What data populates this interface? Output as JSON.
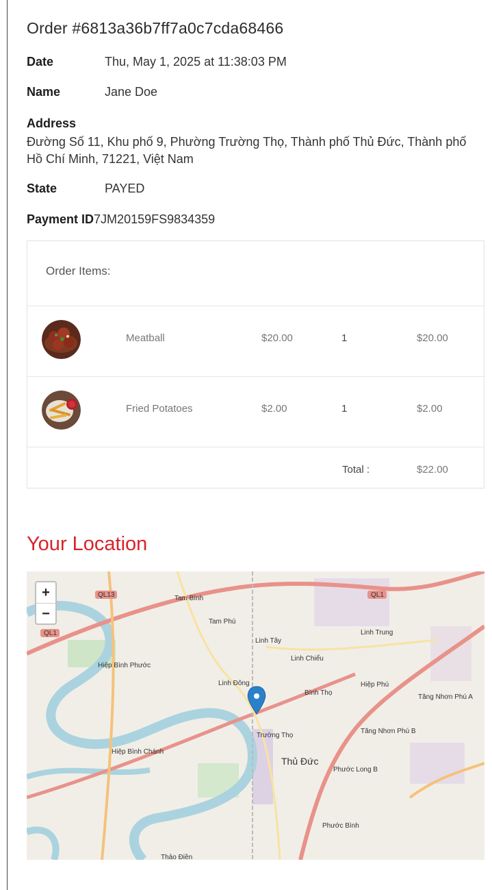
{
  "order": {
    "title": "Order #6813a36b7ff7a0c7cda68466",
    "date_label": "Date",
    "date_value": "Thu, May 1, 2025 at 11:38:03 PM",
    "name_label": "Name",
    "name_value": "Jane Doe",
    "address_label": "Address",
    "address_value": "Đường Số 11, Khu phố 9, Phường Trường Thọ, Thành phố Thủ Đức, Thành phố Hồ Chí Minh, 71221, Việt Nam",
    "state_label": "State",
    "state_value": "PAYED",
    "payment_label": "Payment ID",
    "payment_value": "7JM20159FS9834359"
  },
  "items": {
    "header": "Order Items:",
    "rows": [
      {
        "name": "Meatball",
        "price": "$20.00",
        "qty": "1",
        "subtotal": "$20.00",
        "image": "meatball-photo"
      },
      {
        "name": "Fried Potatoes",
        "price": "$2.00",
        "qty": "1",
        "subtotal": "$2.00",
        "image": "fried-potatoes-photo"
      }
    ],
    "total_label": "Total :",
    "total_value": "$22.00"
  },
  "location": {
    "title": "Your Location",
    "zoom_in": "+",
    "zoom_out": "−",
    "marker_icon": "map-pin-icon",
    "marker_color": "#2a81cb",
    "places": [
      "Tam Bình",
      "Tam Phú",
      "Linh Tây",
      "Linh Chiểu",
      "Linh Đông",
      "Bình Thọ",
      "Hiệp Bình Phước",
      "Hiệp Bình Chánh",
      "Trường Thọ",
      "Thủ Đức",
      "Linh Trung",
      "Hiệp Phú",
      "Tăng Nhơn Phú A",
      "Tăng Nhơn Phú B",
      "Phước Long B",
      "Phước Bình",
      "Thảo Điền",
      "QL13",
      "QL1",
      "QL1"
    ]
  }
}
